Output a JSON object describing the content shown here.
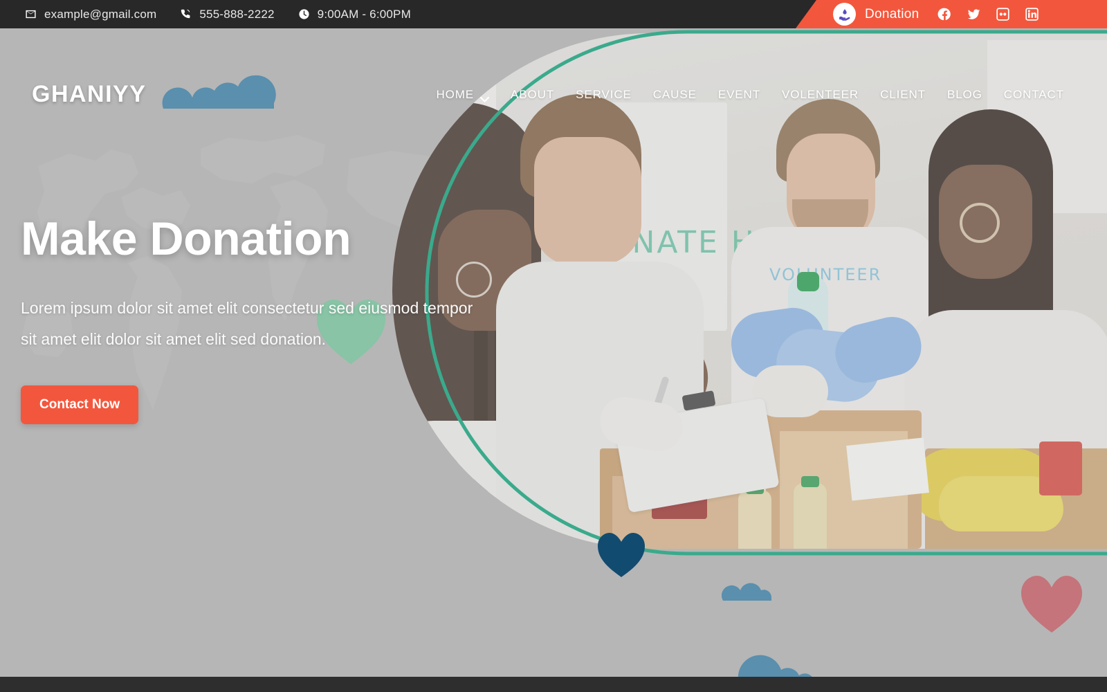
{
  "topbar": {
    "email": "example@gmail.com",
    "phone": "555-888-2222",
    "hours": "9:00AM - 6:00PM",
    "email_icon": "envelope-icon",
    "phone_icon": "phone-icon",
    "hours_icon": "clock-icon",
    "donation_label": "Donation",
    "donation_icon": "hand-holding-drop-icon",
    "socials": [
      {
        "name": "facebook-icon",
        "label": "Facebook"
      },
      {
        "name": "twitter-icon",
        "label": "Twitter"
      },
      {
        "name": "flickr-icon",
        "label": "Flickr"
      },
      {
        "name": "linkedin-icon",
        "label": "LinkedIn"
      }
    ]
  },
  "nav": {
    "logo": "GHANIYY",
    "items": [
      {
        "label": "HOME",
        "has_dropdown": true
      },
      {
        "label": "ABOUT",
        "has_dropdown": false
      },
      {
        "label": "SERVICE",
        "has_dropdown": false
      },
      {
        "label": "CAUSE",
        "has_dropdown": false
      },
      {
        "label": "EVENT",
        "has_dropdown": false
      },
      {
        "label": "VOLENTEER",
        "has_dropdown": false
      },
      {
        "label": "CLIENT",
        "has_dropdown": false
      },
      {
        "label": "BLOG",
        "has_dropdown": false
      },
      {
        "label": "CONTACT",
        "has_dropdown": false
      }
    ]
  },
  "hero": {
    "title": "Make Donation",
    "subtitle": "Lorem ipsum dolor sit amet elit consectetur sed eiusmod tempor sit amet elit dolor sit amet elit sed donation.",
    "cta_label": "Contact Now",
    "image_alt": "volunteers packing donation boxes",
    "whiteboard_text": "DONATE HERE",
    "shirt_text": "VOLUNTEER"
  },
  "colors": {
    "accent_orange": "#f2573d",
    "topbar_dark": "#282828",
    "page_bg": "#b6b6b6",
    "arc_green": "#3aaa8c",
    "heart_green": "#88c4a5",
    "heart_navy": "#124b70",
    "heart_pink": "#c4747a",
    "cloud_blue": "#5a8fad",
    "donation_icon_purple": "#5b4bc4"
  }
}
